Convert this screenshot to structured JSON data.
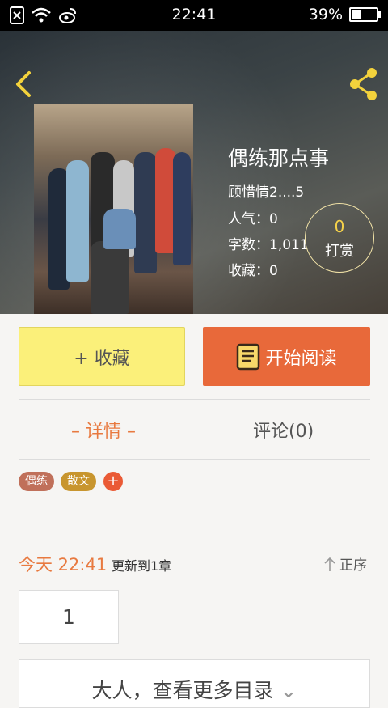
{
  "status_bar": {
    "time": "22:41",
    "battery": "39%",
    "battery_level": 0.39
  },
  "book": {
    "title": "偶练那点事",
    "author": "顾惜情2....5",
    "popularity": "人气：0",
    "word_count": "字数：1,011",
    "favorites": "收藏：0"
  },
  "tip": {
    "count": "0",
    "label": "打赏"
  },
  "actions": {
    "favorite": "+ 收藏",
    "read": "开始阅读"
  },
  "tabs": {
    "detail": "– 详情 –",
    "comment": "评论(0)"
  },
  "tags": [
    {
      "label": "偶练",
      "color": "#c0705a"
    },
    {
      "label": "散文",
      "color": "#c8952e"
    }
  ],
  "tag_add": "+",
  "update": {
    "time": "今天 22:41",
    "text": "更新到1章",
    "sort": "正序"
  },
  "page_number": "1",
  "more_catalog": "大人，查看更多目录"
}
